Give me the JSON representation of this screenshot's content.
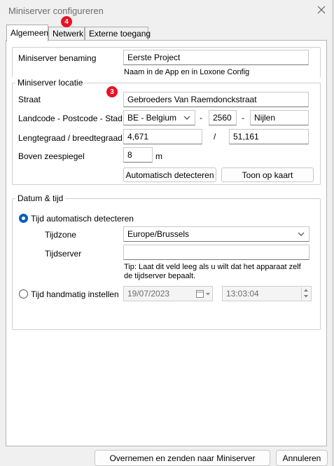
{
  "window": {
    "title": "Miniserver configureren"
  },
  "tabs": [
    {
      "label": "Algemeen",
      "active": true
    },
    {
      "label": "Netwerk",
      "badge": "4"
    },
    {
      "label": "Externe toegang"
    }
  ],
  "general": {
    "name_label": "Miniserver benaming",
    "name_value": "Eerste Project",
    "name_hint": "Naam in de App en in Loxone Config"
  },
  "location": {
    "legend": "Miniserver locatie",
    "badge": "3",
    "street_label": "Straat",
    "street_value": "Gebroeders Van Raemdonckstraat",
    "country_label": "Landcode - Postcode - Stad",
    "country_value": "BE - Belgium",
    "dash1": "-",
    "postcode_value": "2560",
    "dash2": "-",
    "city_value": "Nijlen",
    "coords_label": "Lengtegraad / breedtegraad",
    "longitude_value": "4,671",
    "slash": "/",
    "latitude_value": "51,161",
    "altitude_label": "Boven zeespiegel",
    "altitude_value": "8",
    "altitude_unit": "m",
    "autodetect_button": "Automatisch detecteren",
    "map_button": "Toon op kaart"
  },
  "datetime": {
    "legend": "Datum & tijd",
    "auto_label": "Tijd automatisch detecteren",
    "auto_selected": true,
    "timezone_label": "Tijdzone",
    "timezone_value": "Europe/Brussels",
    "timeserver_label": "Tijdserver",
    "timeserver_value": "",
    "tip_line1": "Tip: Laat dit veld leeg als u wilt dat het apparaat zelf",
    "tip_line2": "de tijdserver bepaalt.",
    "manual_label": "Tijd handmatig instellen",
    "manual_selected": false,
    "date_value": "19/07/2023",
    "time_value": "13:03:04"
  },
  "footer": {
    "apply_button": "Overnemen en zenden naar Miniserver",
    "cancel_button": "Annuleren"
  },
  "colors": {
    "accent": "#005fb8",
    "badge": "#e81123"
  }
}
